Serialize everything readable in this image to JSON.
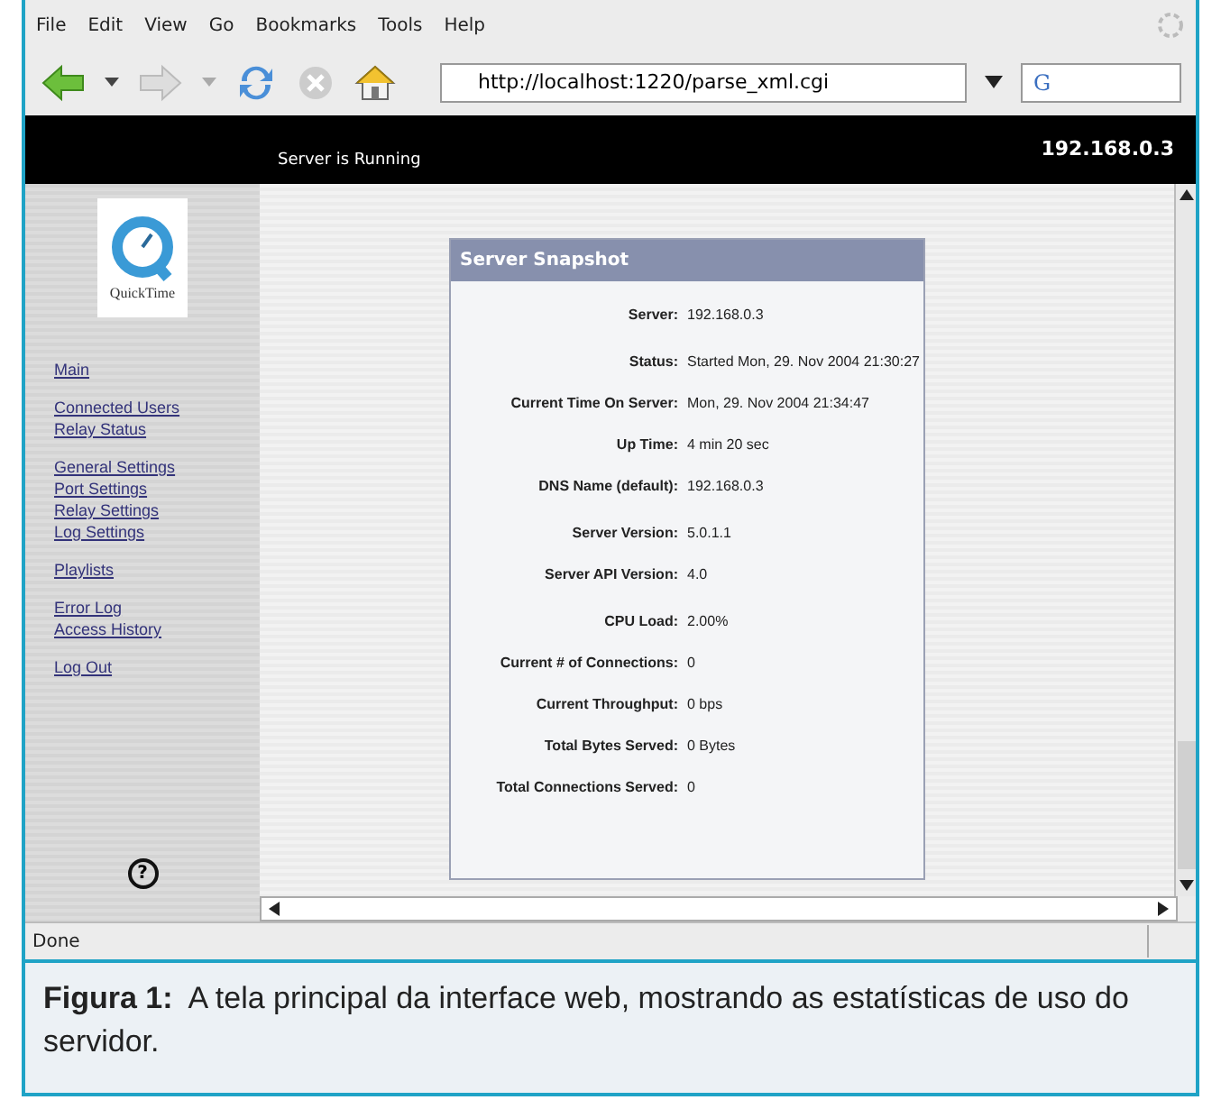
{
  "menu": [
    "File",
    "Edit",
    "View",
    "Go",
    "Bookmarks",
    "Tools",
    "Help"
  ],
  "address": {
    "value": "http://localhost:1220/parse_xml.cgi"
  },
  "search": {
    "value": "G"
  },
  "banner": {
    "status": "Server is Running",
    "host": "192.168.0.3"
  },
  "sidebar": {
    "logo_text": "QuickTime",
    "help": "?",
    "groups": [
      [
        {
          "label": "Main"
        }
      ],
      [
        {
          "label": "Connected Users"
        },
        {
          "label": "Relay Status"
        }
      ],
      [
        {
          "label": "General Settings"
        },
        {
          "label": "Port Settings"
        },
        {
          "label": "Relay Settings"
        },
        {
          "label": "Log Settings"
        }
      ],
      [
        {
          "label": "Playlists"
        }
      ],
      [
        {
          "label": "Error Log"
        },
        {
          "label": "Access History"
        }
      ],
      [
        {
          "label": "Log Out"
        }
      ]
    ]
  },
  "panel": {
    "title": "Server Snapshot",
    "sections": [
      [
        {
          "label": "Server:",
          "value": "192.168.0.3"
        }
      ],
      [
        {
          "label": "Status:",
          "value": "Started Mon, 29. Nov 2004 21:30:27"
        },
        {
          "label": "Current Time On Server:",
          "value": "Mon, 29. Nov 2004 21:34:47"
        },
        {
          "label": "Up Time:",
          "value": "4 min 20 sec"
        },
        {
          "label": "DNS Name (default):",
          "value": "192.168.0.3"
        }
      ],
      [
        {
          "label": "Server Version:",
          "value": "5.0.1.1"
        },
        {
          "label": "Server API Version:",
          "value": "4.0"
        }
      ],
      [
        {
          "label": "CPU Load:",
          "value": "2.00%"
        },
        {
          "label": "Current # of Connections:",
          "value": "0"
        },
        {
          "label": "Current Throughput:",
          "value": "0 bps"
        },
        {
          "label": "Total Bytes Served:",
          "value": "0 Bytes"
        },
        {
          "label": "Total Connections Served:",
          "value": "0"
        }
      ]
    ]
  },
  "status_bar": "Done",
  "caption": "**Figura 1:**  A tela principal da interface web, mostrando as estatísticas de uso do servidor."
}
